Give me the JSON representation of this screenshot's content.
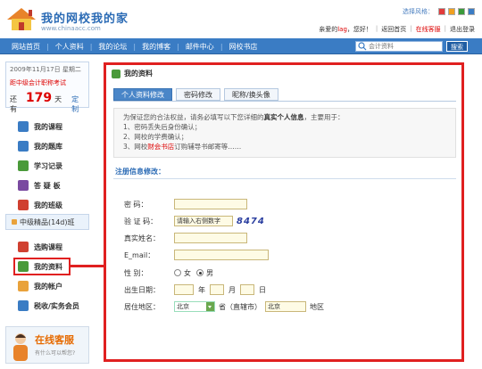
{
  "header": {
    "site_title": "我的网校我的家",
    "site_url": "www.chinaacc.com",
    "style_label": "选择风格：",
    "style_colors": [
      "#e23b3b",
      "#f0a020",
      "#3a9a3a",
      "#3a7cc4"
    ],
    "welcome_prefix": "亲爱的",
    "username": "lag",
    "welcome_suffix": "，您好！",
    "links": [
      "返回首页",
      "在线客服",
      "退出登录"
    ]
  },
  "nav": {
    "items": [
      "网站首页",
      "个人资料",
      "我的论坛",
      "我的博客",
      "邮件中心",
      "网校书店"
    ],
    "search_placeholder": "会计资料",
    "search_button": "搜索"
  },
  "sidebar": {
    "date": "2009年11月17日 星期二",
    "exam_notice": "距中级会计职称考试",
    "days_prefix": "还有",
    "days_count": "179",
    "days_unit": "天",
    "days_link": "定制",
    "menu_top": [
      {
        "label": "我的课程",
        "color": "#3a7cc4"
      },
      {
        "label": "我的题库",
        "color": "#3a7cc4"
      },
      {
        "label": "学习记录",
        "color": "#4a9a3a"
      },
      {
        "label": "答 疑 板",
        "color": "#7a4aa0"
      },
      {
        "label": "我的班级",
        "color": "#d04030"
      }
    ],
    "class_item": "中级精品(14d)班",
    "menu_bottom": [
      {
        "label": "选购课程",
        "color": "#d04030"
      },
      {
        "label": "我的资料",
        "color": "#4a9a3a"
      },
      {
        "label": "我的帐户",
        "color": "#e9a23b"
      },
      {
        "label": "税收/实务会员",
        "color": "#3a7cc4"
      }
    ],
    "cs_title": "在线客服",
    "cs_sub": "有什么可以帮您?"
  },
  "main": {
    "title": "我的资料",
    "tabs": [
      "个人资料修改",
      "密码修改",
      "昵称/换头像"
    ],
    "notice_line1_a": "为保证您的合法权益，请务必填写以下您详细的",
    "notice_line1_b": "真实个人信息",
    "notice_line1_c": "，主要用于：",
    "notice_items": [
      "1、密码丢失后身份确认；",
      "2、网校的学费确认；"
    ],
    "notice_line3_a": "3、网校",
    "notice_line3_b": "财会书店",
    "notice_line3_c": "订购辅导书邮寄等……",
    "section_title": "注册信息修改：",
    "form": {
      "password_label": "密      码：",
      "captcha_label": "验 证 码：",
      "captcha_input": "请输入右侧数字",
      "captcha_code": "8474",
      "realname_label": "真实姓名：",
      "email_label": "E_mail：",
      "gender_label": "性      别：",
      "gender_female": "女",
      "gender_male": "男",
      "gender_selected": "男",
      "birth_label": "出生日期：",
      "year": "年",
      "month": "月",
      "day": "日",
      "region_label": "居住地区：",
      "province": "北京",
      "province_suffix": "省（直辖市）",
      "city": "北京",
      "city_suffix": "地区"
    }
  }
}
